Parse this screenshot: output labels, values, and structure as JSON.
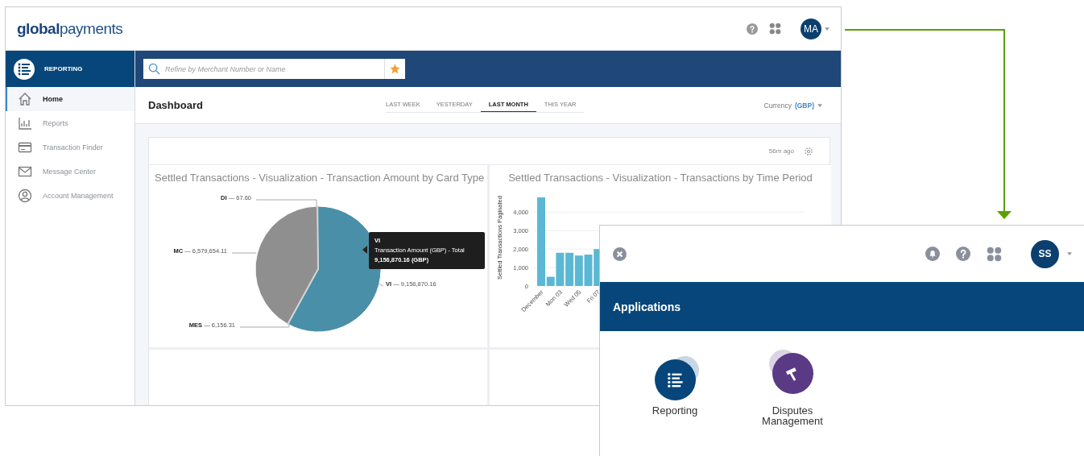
{
  "main_window": {
    "logo": "**global**payments",
    "header_icons": {
      "avatar": "MA"
    },
    "sidebar": {
      "title": "REPORTING",
      "items": [
        {
          "label": "Home",
          "selected": true
        },
        {
          "label": "Reports",
          "selected": false
        },
        {
          "label": "Transaction Finder",
          "selected": false
        },
        {
          "label": "Message Center",
          "selected": false
        },
        {
          "label": "Account Management",
          "selected": false
        }
      ]
    },
    "search": {
      "placeholder": "Refine by Merchant Number or Name"
    },
    "dashboard": {
      "title": "Dashboard",
      "tabs": [
        {
          "label": "LAST WEEK",
          "selected": false
        },
        {
          "label": "YESTERDAY",
          "selected": false
        },
        {
          "label": "LAST MONTH",
          "selected": true
        },
        {
          "label": "THIS YEAR",
          "selected": false
        }
      ],
      "currency_label": "Currency",
      "currency_value": "(GBP)",
      "updated": "56m ago"
    },
    "panels": [
      {
        "title": "Settled Transactions - Visualization - Transaction Amount by Card Type",
        "chart_data": {
          "type": "pie",
          "categories": [
            "DI",
            "MC",
            "MES",
            "VI"
          ],
          "values": [
            67.6,
            6579654.11,
            6156.31,
            9156870.16
          ],
          "colors": [
            "#d4d4d4",
            "#8f8f8f",
            "#d4d4d4",
            "#4a8fa8"
          ],
          "value_labels": [
            "— 67.60",
            "— 6,579,654.11",
            "— 6,156.31",
            "— 9,156,870.16"
          ]
        },
        "tooltip": {
          "title": "VI",
          "line": "Transaction Amount (GBP) - Total",
          "value": "9,156,870.16 (GBP)"
        }
      },
      {
        "title": "Settled Transactions - Visualization - Transactions by Time Period",
        "chart_data": {
          "type": "bar",
          "ylabel": "Settled Transactions Paginated",
          "categories": [
            "December",
            null,
            "Mon 03",
            null,
            "Wed 05",
            null,
            "Fri 07"
          ],
          "series": [
            {
              "color": "#5bb8d4",
              "values": [
                4800,
                500,
                1800,
                1800,
                1650,
                1700,
                2000
              ]
            }
          ],
          "grid": true,
          "ylim": [
            0,
            4800
          ],
          "yticks": [
            {
              "value": 0,
              "label": "0"
            },
            {
              "value": 1000,
              "label": "1,000"
            },
            {
              "value": 2000,
              "label": "2,000"
            },
            {
              "value": 3000,
              "label": "3,000"
            },
            {
              "value": 4000,
              "label": "4,000"
            }
          ]
        }
      }
    ]
  },
  "apps_window": {
    "avatar": "SS",
    "title": "Applications",
    "apps": [
      {
        "label": "Reporting",
        "color": "#07467a"
      },
      {
        "label": "Disputes Management",
        "color": "#5a3a85"
      }
    ]
  }
}
